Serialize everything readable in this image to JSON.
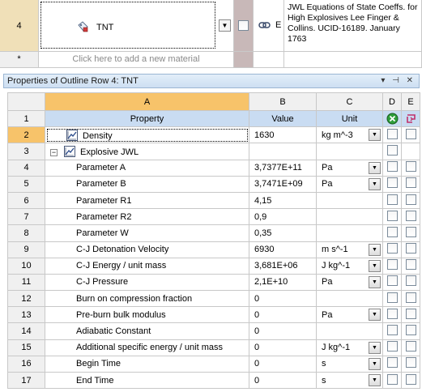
{
  "outline": {
    "row_number": "4",
    "material_name": "TNT",
    "description": "JWL Equations of State Coeffs. for High Explosives Lee Finger & Collins. UCID-16189. January 1763",
    "link_letter": "E",
    "new_row_marker": "*",
    "new_row_placeholder": "Click here to add a new material"
  },
  "properties_panel": {
    "title": "Properties of Outline Row 4: TNT",
    "tool_icons": [
      "pin-icon",
      "auto-hide-icon",
      "close-icon"
    ],
    "tools_text": "▾ ⊣ ✕",
    "column_letters": [
      "A",
      "B",
      "C",
      "D",
      "E"
    ],
    "headers": {
      "row": "1",
      "property": "Property",
      "value": "Value",
      "unit": "Unit"
    },
    "rows": [
      {
        "n": "2",
        "property": "Density",
        "value": "1630",
        "unit": "kg m^-3",
        "level": 0,
        "icon": true,
        "dropdown": true,
        "d": true,
        "e": true
      },
      {
        "n": "3",
        "property": "Explosive JWL",
        "value": "",
        "unit": "",
        "level": 0,
        "icon": true,
        "expander": "−",
        "dropdown": false,
        "d": true,
        "e": false
      },
      {
        "n": "4",
        "property": "Parameter A",
        "value": "3,7377E+11",
        "unit": "Pa",
        "level": 1,
        "dropdown": true,
        "d": true,
        "e": true
      },
      {
        "n": "5",
        "property": "Parameter B",
        "value": "3,7471E+09",
        "unit": "Pa",
        "level": 1,
        "dropdown": true,
        "d": true,
        "e": true
      },
      {
        "n": "6",
        "property": "Parameter R1",
        "value": "4,15",
        "unit": "",
        "level": 1,
        "dropdown": false,
        "d": true,
        "e": true
      },
      {
        "n": "7",
        "property": "Parameter R2",
        "value": "0,9",
        "unit": "",
        "level": 1,
        "dropdown": false,
        "d": true,
        "e": true
      },
      {
        "n": "8",
        "property": "Parameter W",
        "value": "0,35",
        "unit": "",
        "level": 1,
        "dropdown": false,
        "d": true,
        "e": true
      },
      {
        "n": "9",
        "property": "C-J Detonation Velocity",
        "value": "6930",
        "unit": "m s^-1",
        "level": 1,
        "dropdown": true,
        "d": true,
        "e": true
      },
      {
        "n": "10",
        "property": "C-J Energy / unit mass",
        "value": "3,681E+06",
        "unit": "J kg^-1",
        "level": 1,
        "dropdown": true,
        "d": true,
        "e": true
      },
      {
        "n": "11",
        "property": "C-J Pressure",
        "value": "2,1E+10",
        "unit": "Pa",
        "level": 1,
        "dropdown": true,
        "d": true,
        "e": true
      },
      {
        "n": "12",
        "property": "Burn on compression fraction",
        "value": "0",
        "unit": "",
        "level": 1,
        "dropdown": false,
        "d": true,
        "e": true
      },
      {
        "n": "13",
        "property": "Pre-burn bulk modulus",
        "value": "0",
        "unit": "Pa",
        "level": 1,
        "dropdown": true,
        "d": true,
        "e": true
      },
      {
        "n": "14",
        "property": "Adiabatic Constant",
        "value": "0",
        "unit": "",
        "level": 1,
        "dropdown": false,
        "d": true,
        "e": true
      },
      {
        "n": "15",
        "property": "Additional specific energy / unit mass",
        "value": "0",
        "unit": "J kg^-1",
        "level": 1,
        "dropdown": true,
        "d": true,
        "e": true
      },
      {
        "n": "16",
        "property": "Begin Time",
        "value": "0",
        "unit": "s",
        "level": 1,
        "dropdown": true,
        "d": true,
        "e": true
      },
      {
        "n": "17",
        "property": "End Time",
        "value": "0",
        "unit": "s",
        "level": 1,
        "dropdown": true,
        "d": true,
        "e": true
      }
    ]
  },
  "colors": {
    "selected_header": "#f7c36a",
    "property_header": "#c9dcf2",
    "title_bar": "#cddff2"
  }
}
